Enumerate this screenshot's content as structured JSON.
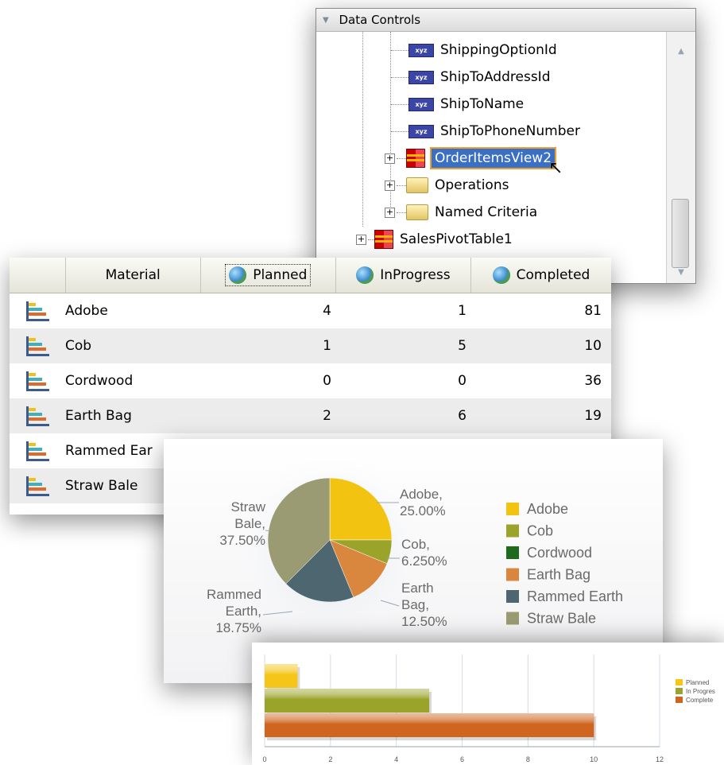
{
  "data_controls": {
    "title": "Data Controls",
    "items": [
      {
        "label": "ShippingOptionId",
        "icon": "attribute-icon"
      },
      {
        "label": "ShipToAddressId",
        "icon": "attribute-icon"
      },
      {
        "label": "ShipToName",
        "icon": "attribute-icon"
      },
      {
        "label": "ShipToPhoneNumber",
        "icon": "attribute-icon"
      },
      {
        "label": "OrderItemsView2",
        "icon": "collection-icon",
        "selected": true
      },
      {
        "label": "Operations",
        "icon": "folder-icon"
      },
      {
        "label": "Named Criteria",
        "icon": "folder-icon"
      },
      {
        "label": "SalesPivotTable1",
        "icon": "collection-icon"
      }
    ],
    "attr_glyph": "xyz"
  },
  "pivot_table": {
    "headers": [
      "Material",
      "Planned",
      "InProgress",
      "Completed"
    ],
    "rows": [
      {
        "material": "Adobe",
        "planned": "4",
        "inprogress": "1",
        "completed": "81"
      },
      {
        "material": "Cob",
        "planned": "1",
        "inprogress": "5",
        "completed": "10"
      },
      {
        "material": "Cordwood",
        "planned": "0",
        "inprogress": "0",
        "completed": "36"
      },
      {
        "material": "Earth Bag",
        "planned": "2",
        "inprogress": "6",
        "completed": "19"
      },
      {
        "material": "Rammed Ear",
        "planned": "",
        "inprogress": "",
        "completed": ""
      },
      {
        "material": "Straw Bale",
        "planned": "",
        "inprogress": "",
        "completed": ""
      }
    ]
  },
  "chart_data": [
    {
      "type": "pie",
      "slices": [
        {
          "label": "Adobe",
          "value": 25.0,
          "display": "Adobe, 25.00%",
          "color": "#f2c411"
        },
        {
          "label": "Cob",
          "value": 6.25,
          "display": "Cob, 6.250%",
          "color": "#9aa32a"
        },
        {
          "label": "Cordwood",
          "value": 0,
          "display": "",
          "color": "#1e6b1e"
        },
        {
          "label": "Earth Bag",
          "value": 12.5,
          "display": "Earth Bag, 12.50%",
          "color": "#d9873e"
        },
        {
          "label": "Rammed Earth",
          "value": 18.75,
          "display": "Rammed Earth, 18.75%",
          "color": "#4d6670"
        },
        {
          "label": "Straw Bale",
          "value": 37.5,
          "display": "Straw Bale, 37.50%",
          "color": "#9b9b73"
        }
      ],
      "legend": [
        "Adobe",
        "Cob",
        "Cordwood",
        "Earth Bag",
        "Rammed Earth",
        "Straw Bale"
      ],
      "label_lines": {
        "adobe": [
          "Adobe,",
          "25.00%"
        ],
        "cob": [
          "Cob,",
          "6.250%"
        ],
        "earthbag": [
          "Earth",
          "Bag,",
          "12.50%"
        ],
        "rammed": [
          "Rammed",
          "Earth,",
          "18.75%"
        ],
        "straw": [
          "Straw",
          "Bale,",
          "37.50%"
        ]
      }
    },
    {
      "type": "bar",
      "orientation": "horizontal",
      "series": [
        {
          "name": "Planned",
          "values": [
            1
          ],
          "color": "#f5c518"
        },
        {
          "name": "InProgress",
          "values": [
            5
          ],
          "color": "#9aa32a"
        },
        {
          "name": "Completed",
          "values": [
            10
          ],
          "color": "#d0651f"
        }
      ],
      "legend_text": [
        "Planned",
        "In Progres",
        "Complete"
      ],
      "xlim": [
        0,
        12
      ],
      "xticks": [
        "0",
        "2",
        "4",
        "6",
        "8",
        "10",
        "12"
      ]
    }
  ]
}
